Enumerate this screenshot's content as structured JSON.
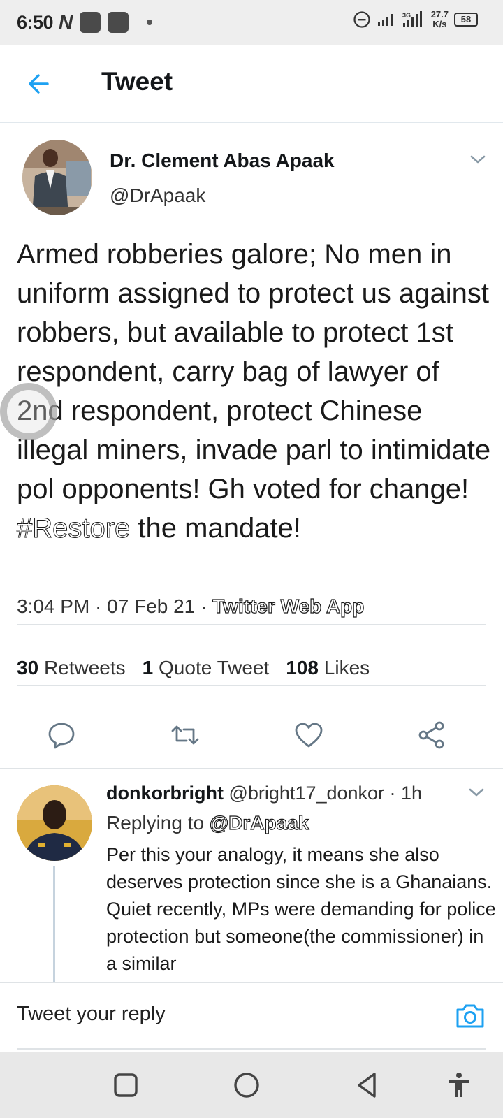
{
  "status_bar": {
    "time": "6:50",
    "carrier_glyph": "N",
    "speed_value": "27.7",
    "speed_unit": "K/s",
    "battery": "58"
  },
  "header": {
    "title": "Tweet"
  },
  "tweet": {
    "author_name": "Dr. Clement Abas Apaak",
    "author_handle": "@DrApaak",
    "text": "Armed robberies galore; No men in uniform assigned to protect us against robbers, but available to protect 1st respondent, carry bag of lawyer of 2nd respondent, protect Chinese illegal miners, invade parl to intimidate pol opponents! Gh voted for change! ",
    "hashtag": "#Restore",
    "text_end": " the mandate!",
    "time": "3:04 PM · 07 Feb 21 · ",
    "source": "Twitter Web App",
    "stats": {
      "retweets_count": "30",
      "retweets_label": "Retweets",
      "quotes_count": "1",
      "quotes_label": "Quote Tweet",
      "likes_count": "108",
      "likes_label": "Likes"
    }
  },
  "reply": {
    "name": "donkorbright",
    "handle_time": " @bright17_donkor · 1h",
    "replying_prefix": "Replying to ",
    "replying_to": "@DrApaak",
    "body": "Per this your analogy, it means she also deserves protection since she is a Ghanaians. Quiet recently, MPs were demanding for police protection but someone(the commissioner) in a similar"
  },
  "reply_bar": {
    "placeholder": "Tweet your reply"
  },
  "icons": {
    "back": "arrow-left-icon",
    "reply": "comment-icon",
    "retweet": "retweet-icon",
    "like": "heart-icon",
    "share": "share-icon",
    "camera": "camera-icon"
  },
  "colors": {
    "accent": "#1da1f2",
    "icon_gray": "#657786"
  }
}
